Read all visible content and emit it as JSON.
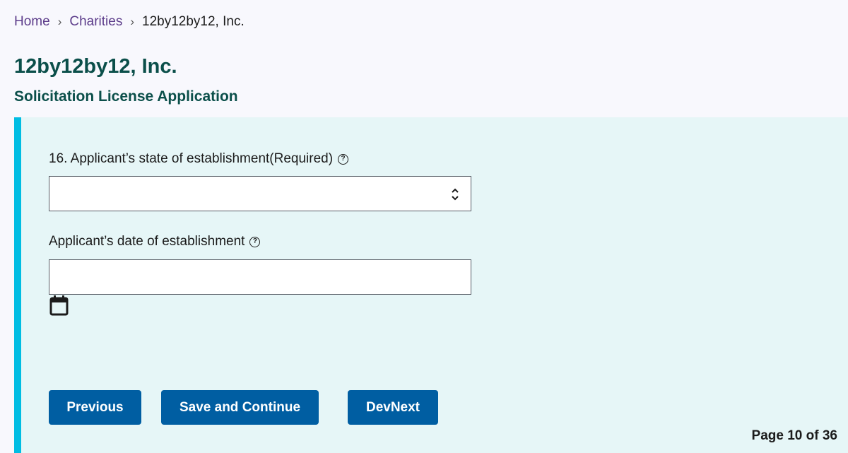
{
  "breadcrumb": {
    "items": [
      {
        "label": "Home"
      },
      {
        "label": "Charities"
      }
    ],
    "current": "12by12by12, Inc.",
    "separator": "›"
  },
  "header": {
    "title": "12by12by12, Inc.",
    "subtitle": "Solicitation License Application"
  },
  "form": {
    "state_field": {
      "label": "16. Applicant’s state of establishment(Required)",
      "value": "",
      "help_icon": "question-circle-icon"
    },
    "date_field": {
      "label": "Applicant’s date of establishment",
      "value": "",
      "help_icon": "question-circle-icon",
      "picker_icon": "calendar-icon"
    }
  },
  "buttons": {
    "previous": "Previous",
    "save_continue": "Save and Continue",
    "dev_next": "DevNext"
  },
  "pagination": {
    "text": "Page 10 of 36",
    "current": 10,
    "total": 36
  },
  "colors": {
    "accent_bar": "#00bde3",
    "panel_bg": "#e6f6f7",
    "button_bg": "#005ea2",
    "title": "#0b4f4a",
    "link": "#5c3c8a"
  }
}
